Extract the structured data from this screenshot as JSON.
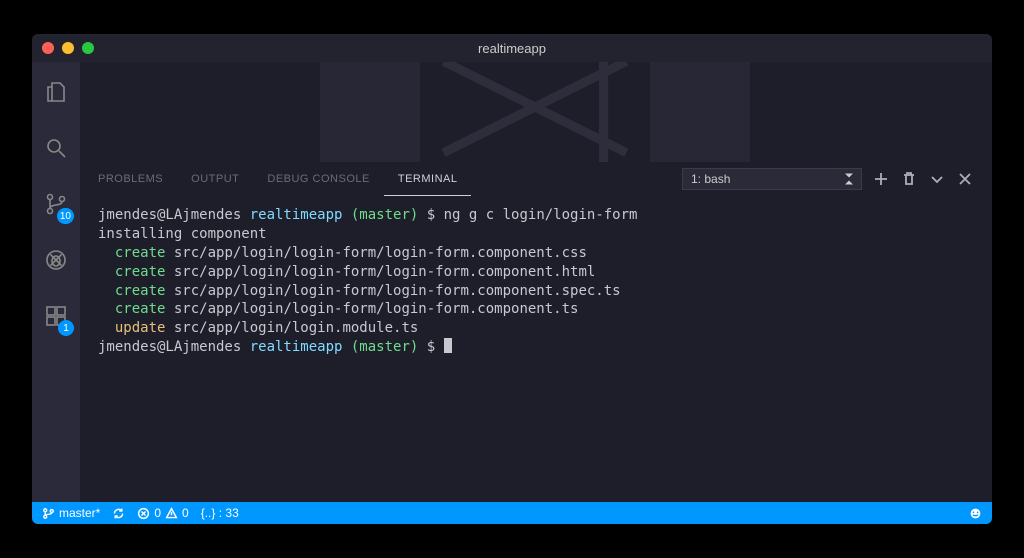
{
  "window": {
    "title": "realtimeapp"
  },
  "activityBar": {
    "scmBadge": "10",
    "extBadge": "1"
  },
  "panel": {
    "tabs": {
      "problems": "PROBLEMS",
      "output": "OUTPUT",
      "debug": "DEBUG CONSOLE",
      "terminal": "TERMINAL"
    },
    "terminalSelector": "1: bash"
  },
  "terminal": {
    "prompt1_user": "jmendes@LAjmendes",
    "prompt1_dir": "realtimeapp",
    "prompt1_branch": "(master)",
    "prompt1_cmd": "ng g c login/login-form",
    "installing": "installing component",
    "lines": [
      {
        "verb": "create",
        "path": "src/app/login/login-form/login-form.component.css"
      },
      {
        "verb": "create",
        "path": "src/app/login/login-form/login-form.component.html"
      },
      {
        "verb": "create",
        "path": "src/app/login/login-form/login-form.component.spec.ts"
      },
      {
        "verb": "create",
        "path": "src/app/login/login-form/login-form.component.ts"
      },
      {
        "verb": "update",
        "path": "src/app/login/login.module.ts"
      }
    ],
    "prompt2_user": "jmendes@LAjmendes",
    "prompt2_dir": "realtimeapp",
    "prompt2_branch": "(master)"
  },
  "statusBar": {
    "branch": "master*",
    "errors": "0",
    "warnings": "0",
    "diff": "{..} : 33"
  }
}
